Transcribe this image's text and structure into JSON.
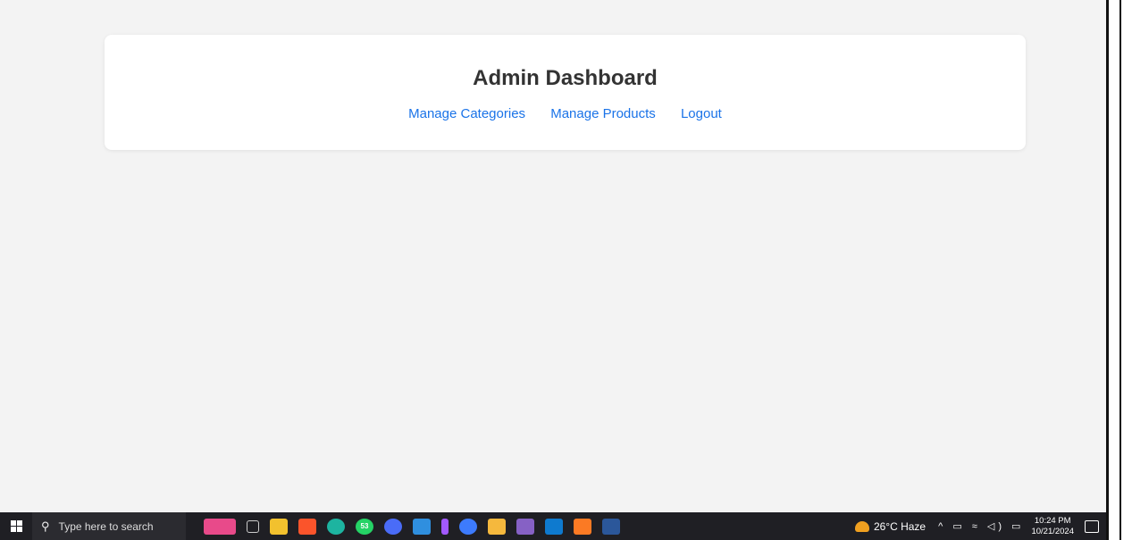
{
  "page": {
    "title": "Admin Dashboard",
    "nav": [
      {
        "label": "Manage Categories"
      },
      {
        "label": "Manage Products"
      },
      {
        "label": "Logout"
      }
    ],
    "link_color": "#1a73e8",
    "background": "#f3f3f3"
  },
  "taskbar": {
    "search_placeholder": "Type here to search",
    "apps": [
      {
        "icon": "widgets-icon",
        "color": "#e84a8a"
      },
      {
        "icon": "task-view-icon",
        "color": "#3a3a40"
      },
      {
        "icon": "file-explorer-icon",
        "color": "#f2c12e"
      },
      {
        "icon": "brave-browser-icon",
        "color": "#fb542b"
      },
      {
        "icon": "edge-browser-icon",
        "color": "#1db4a0"
      },
      {
        "icon": "whatsapp-icon",
        "color": "#25d366",
        "badge": "53"
      },
      {
        "icon": "app-blue-icon",
        "color": "#4a6cf7"
      },
      {
        "icon": "app-cube-icon",
        "color": "#2f8fdf"
      },
      {
        "icon": "figma-icon",
        "color": "#a259ff"
      },
      {
        "icon": "app-play-icon",
        "color": "#3d7bfd"
      },
      {
        "icon": "medal-icon",
        "color": "#f5b83d"
      },
      {
        "icon": "visual-studio-icon",
        "color": "#8661c5"
      },
      {
        "icon": "vscode-icon",
        "color": "#0e7acf"
      },
      {
        "icon": "xampp-icon",
        "color": "#fb7a24"
      },
      {
        "icon": "word-icon",
        "color": "#2b579a"
      }
    ],
    "weather": "26°C Haze",
    "time": "10:24 PM",
    "date": "10/21/2024"
  }
}
